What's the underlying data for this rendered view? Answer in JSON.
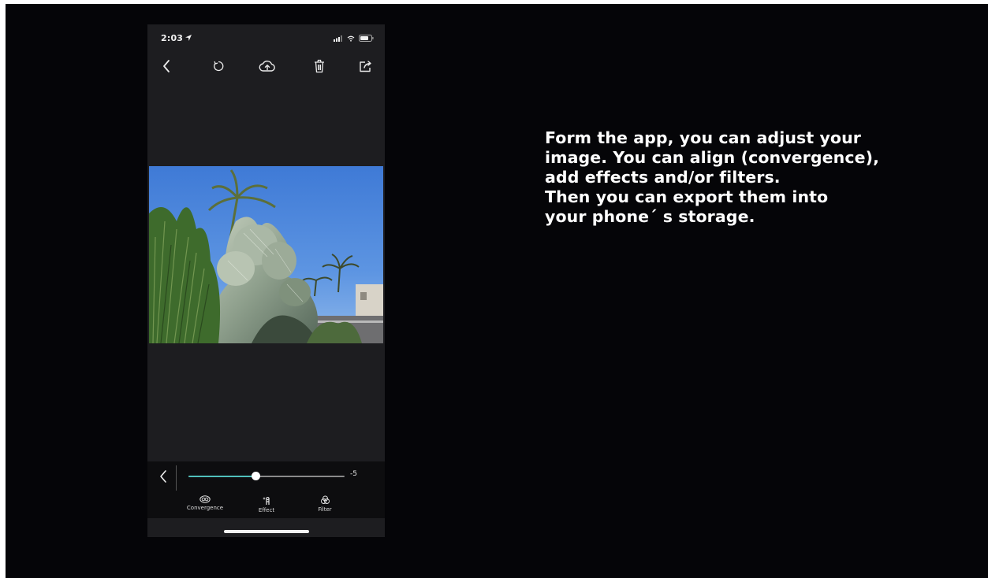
{
  "status_bar": {
    "time": "2:03"
  },
  "toolbar": {
    "icons": [
      "back-chevron-icon",
      "reset-icon",
      "cloud-upload-icon",
      "trash-icon",
      "share-icon"
    ]
  },
  "adjust_panel": {
    "slider_value_label": "-5",
    "slider_level": 0.43,
    "accent_color": "#4fc0bb",
    "tabs": [
      {
        "label": "Convergence",
        "icon": "convergence-icon"
      },
      {
        "label": "Effect",
        "icon": "effect-wand-icon"
      },
      {
        "label": "Filter",
        "icon": "filter-circles-icon"
      }
    ]
  },
  "caption": {
    "lines": [
      "Form the app, you can adjust your",
      "image.  You can align (convergence),",
      "add effects and/or filters.",
      "Then you can export them into",
      "your phone´ s storage."
    ]
  }
}
